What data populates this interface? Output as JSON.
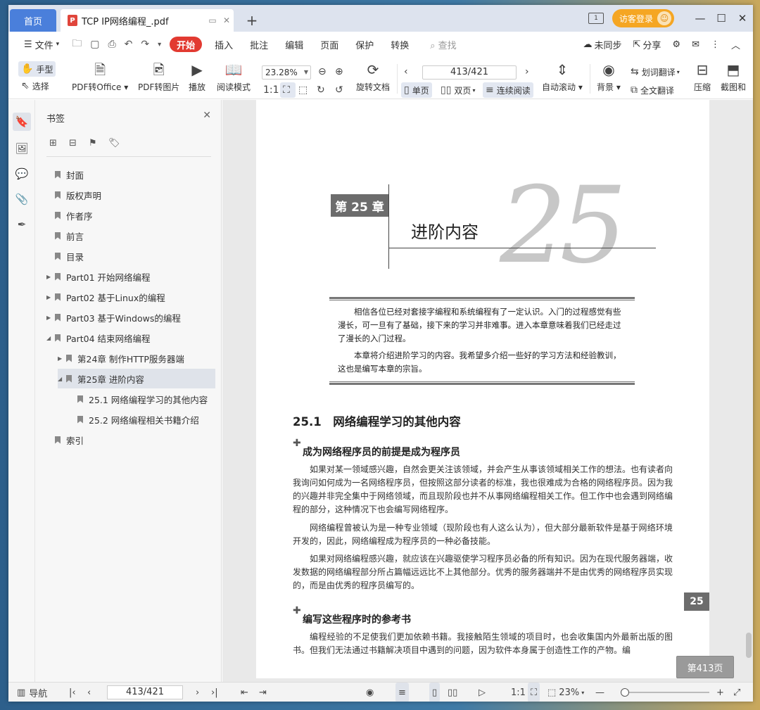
{
  "tabs": {
    "home": "首页",
    "doc_title": "TCP IP网络编程_.pdf",
    "pdf_badge": "P",
    "new_tab": "+"
  },
  "titlebar": {
    "login": "访客登录"
  },
  "menu": {
    "file": "文件",
    "items": [
      "开始",
      "插入",
      "批注",
      "编辑",
      "页面",
      "保护",
      "转换"
    ],
    "search_placeholder": "查找",
    "unsync": "未同步",
    "share": "分享"
  },
  "ribbon": {
    "hand": "手型",
    "select": "选择",
    "pdf_office": "PDF转Office",
    "pdf_image": "PDF转图片",
    "play": "播放",
    "read_mode": "阅读模式",
    "zoom": "23.28%",
    "rotate": "旋转文档",
    "page_input": "413/421",
    "single": "单页",
    "double": "双页",
    "continuous": "连续阅读",
    "autoscroll": "自动滚动",
    "background": "背景",
    "word_translate": "划词翻译",
    "full_translate": "全文翻译",
    "compress": "压缩",
    "screenshot": "截图和"
  },
  "bookmarks": {
    "title": "书签",
    "items": [
      {
        "label": "封面"
      },
      {
        "label": "版权声明"
      },
      {
        "label": "作者序"
      },
      {
        "label": "前言"
      },
      {
        "label": "目录"
      },
      {
        "label": "Part01 开始网络编程"
      },
      {
        "label": "Part02 基于Linux的编程"
      },
      {
        "label": "Part03 基于Windows的编程"
      },
      {
        "label": "Part04 结束网络编程"
      },
      {
        "label": "第24章 制作HTTP服务器端"
      },
      {
        "label": "第25章 进阶内容"
      },
      {
        "label": "25.1 网络编程学习的其他内容"
      },
      {
        "label": "25.2 网络编程相关书籍介绍"
      },
      {
        "label": "索引"
      }
    ]
  },
  "page": {
    "chapter_box": "第 25 章",
    "chapter_title": "进阶内容",
    "chapter_number": "25",
    "intro1": "相信各位已经对套接字编程和系统编程有了一定认识。入门的过程感觉有些漫长，可一旦有了基础，接下来的学习并非难事。进入本章意味着我们已经走过了漫长的入门过程。",
    "intro2": "本章将介绍进阶学习的内容。我希望多介绍一些好的学习方法和经验教训，这也是编写本章的宗旨。",
    "section": "25.1　网络编程学习的其他内容",
    "sub1": "成为网络程序员的前提是成为程序员",
    "p1": "如果对某一领域感兴趣，自然会更关注该领域，并会产生从事该领域相关工作的想法。也有读者向我询问如何成为一名网络程序员，但按照这部分读者的标准，我也很难成为合格的网络程序员。因为我的兴趣并非完全集中于网络领域，而且现阶段也并不从事网络编程相关工作。但工作中也会遇到网络编程的部分，这种情况下也会编写网络程序。",
    "p2": "网络编程曾被认为是一种专业领域（现阶段也有人这么认为），但大部分最新软件是基于网络环境开发的，因此，网络编程成为程序员的一种必备技能。",
    "p3": "如果对网络编程感兴趣，就应该在兴趣驱使学习程序员必备的所有知识。因为在现代服务器端，收发数据的网络编程部分所占篇幅远远比不上其他部分。优秀的服务器端并不是由优秀的网络程序员实现的，而是由优秀的程序员编写的。",
    "sub2": "编写这些程序时的参考书",
    "p4": "编程经验的不足使我们更加依赖书籍。我接触陌生领域的项目时，也会收集国内外最新出版的图书。但我们无法通过书籍解决项目中遇到的问题，因为软件本身属于创造性工作的产物。编",
    "page_number_tab": "25"
  },
  "page_label": "第413页",
  "status": {
    "nav": "导航",
    "page": "413/421",
    "zoom": "23%"
  }
}
